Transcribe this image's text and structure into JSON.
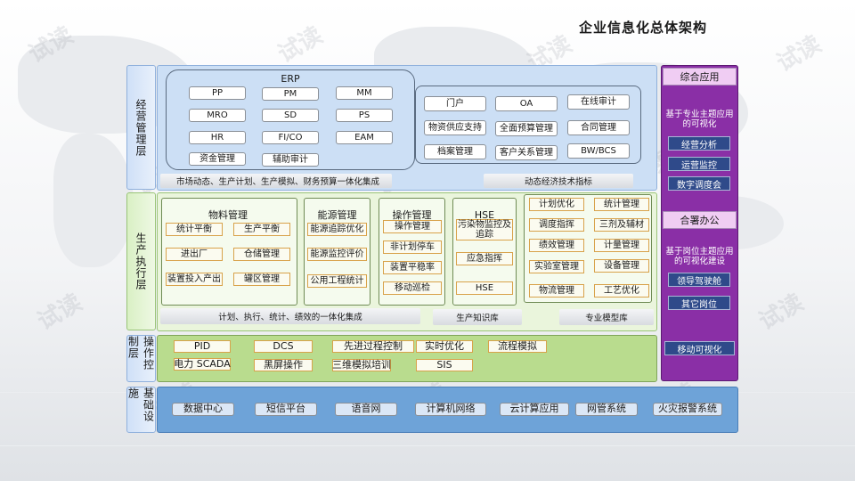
{
  "title": "企业信息化总体架构",
  "watermark": "试读",
  "layers": {
    "business": "经营管理层",
    "production": "生产执行层",
    "control": "操作控制层",
    "infrastructure": "基础设施"
  },
  "erp": {
    "title": "ERP",
    "modules": [
      "PP",
      "PM",
      "MM",
      "MRO",
      "SD",
      "PS",
      "HR",
      "FI/CO",
      "EAM",
      "资金管理",
      "辅助审计"
    ]
  },
  "business_systems": [
    "门户",
    "OA",
    "在线审计",
    "物资供应支持",
    "全面预算管理",
    "合同管理",
    "档案管理",
    "客户关系管理",
    "BW/BCS"
  ],
  "business_strips": {
    "left": "市场动态、生产计划、生产模拟、财务预算一体化集成",
    "right": "动态经济技术指标"
  },
  "material": {
    "title": "物料管理",
    "items": [
      "统计平衡",
      "生产平衡",
      "进出厂",
      "仓储管理",
      "装置投入产出",
      "罐区管理"
    ]
  },
  "energy": {
    "title": "能源管理",
    "items": [
      "能源追踪优化",
      "能源监控评价",
      "公用工程统计"
    ]
  },
  "operation": {
    "title": "操作管理",
    "items": [
      "操作管理",
      "非计划停车",
      "装置平稳率",
      "移动巡检"
    ]
  },
  "hse": {
    "title": "HSE",
    "items": [
      "污染物监控及追踪",
      "应急指挥",
      "HSE"
    ]
  },
  "right_col1": [
    "计划优化",
    "调度指挥",
    "绩效管理",
    "实验室管理",
    "物流管理"
  ],
  "right_col2": [
    "统计管理",
    "三剂及辅材",
    "计量管理",
    "设备管理",
    "工艺优化"
  ],
  "production_strips": {
    "left": "计划、执行、统计、绩效的一体化集成",
    "mid": "生产知识库",
    "right": "专业模型库"
  },
  "control_items": [
    "PID",
    "DCS",
    "先进过程控制",
    "实时优化",
    "流程模拟",
    "电力 SCADA",
    "黑屏操作",
    "三维模拟培训",
    "SIS"
  ],
  "infra_items": [
    "数据中心",
    "短信平台",
    "语音网",
    "计算机网络",
    "云计算应用",
    "网管系统",
    "火灾报警系统"
  ],
  "right_panel": {
    "integrated": "综合应用",
    "desc1": "基于专业主题应用的可视化",
    "items1": [
      "经营分析",
      "运营监控",
      "数字调度会"
    ],
    "cooperative": "合署办公",
    "desc2": "基于岗位主题应用的可视化建设",
    "items2": [
      "领导驾驶舱",
      "其它岗位"
    ],
    "mobile": "移动可视化"
  },
  "colors": {
    "blue_panel": "#ccdff5",
    "green_panel": "#eaf5dc",
    "control_panel": "#b9dc8e",
    "infra_panel": "#6ea3d8",
    "purple_panel": "#8a2fa6"
  }
}
